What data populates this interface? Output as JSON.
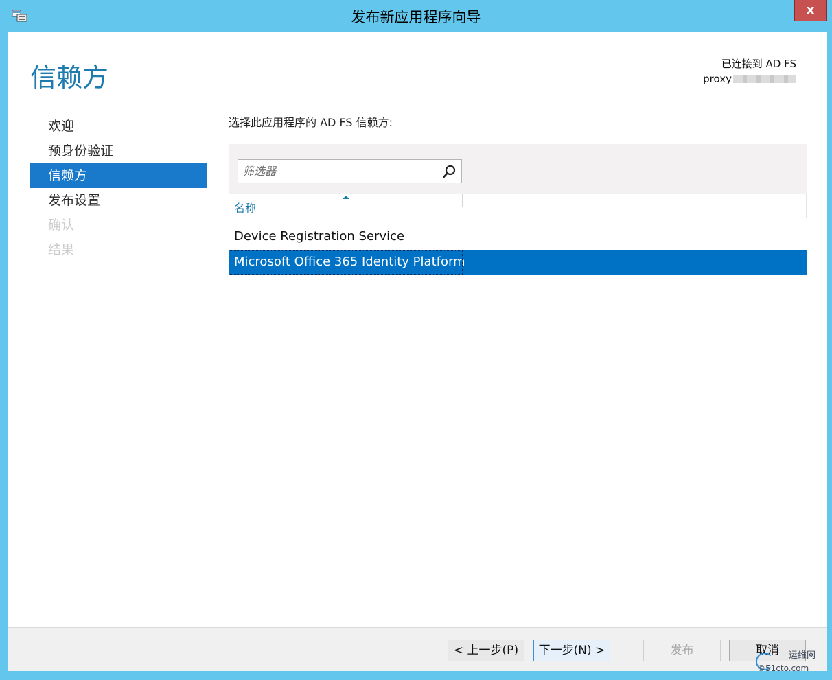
{
  "window": {
    "title": "发布新应用程序向导",
    "close_label": "x"
  },
  "page": {
    "title": "信赖方",
    "connection_line1": "已连接到 AD FS",
    "connection_line2": "proxy"
  },
  "nav": {
    "items": [
      {
        "label": "欢迎",
        "state": "normal"
      },
      {
        "label": "预身份验证",
        "state": "normal"
      },
      {
        "label": "信赖方",
        "state": "active"
      },
      {
        "label": "发布设置",
        "state": "normal"
      },
      {
        "label": "确认",
        "state": "disabled"
      },
      {
        "label": "结果",
        "state": "disabled"
      }
    ]
  },
  "main": {
    "instruction": "选择此应用程序的 AD FS 信赖方:",
    "filter_placeholder": "筛选器",
    "column_name": "名称",
    "rows": [
      {
        "name": "Device Registration Service",
        "selected": false
      },
      {
        "name": "Microsoft Office 365 Identity Platform",
        "selected": true
      }
    ]
  },
  "footer": {
    "prev_label": "< 上一步(P)",
    "next_label": "下一步(N) >",
    "publish_label": "发布",
    "cancel_label": "取消"
  },
  "watermark": {
    "line1": "运维网",
    "line2": "©51cto.com"
  },
  "colors": {
    "titlebar": "#63c6ec",
    "accent": "#1e7bb0",
    "selection": "#0072c6",
    "close": "#c75050"
  }
}
